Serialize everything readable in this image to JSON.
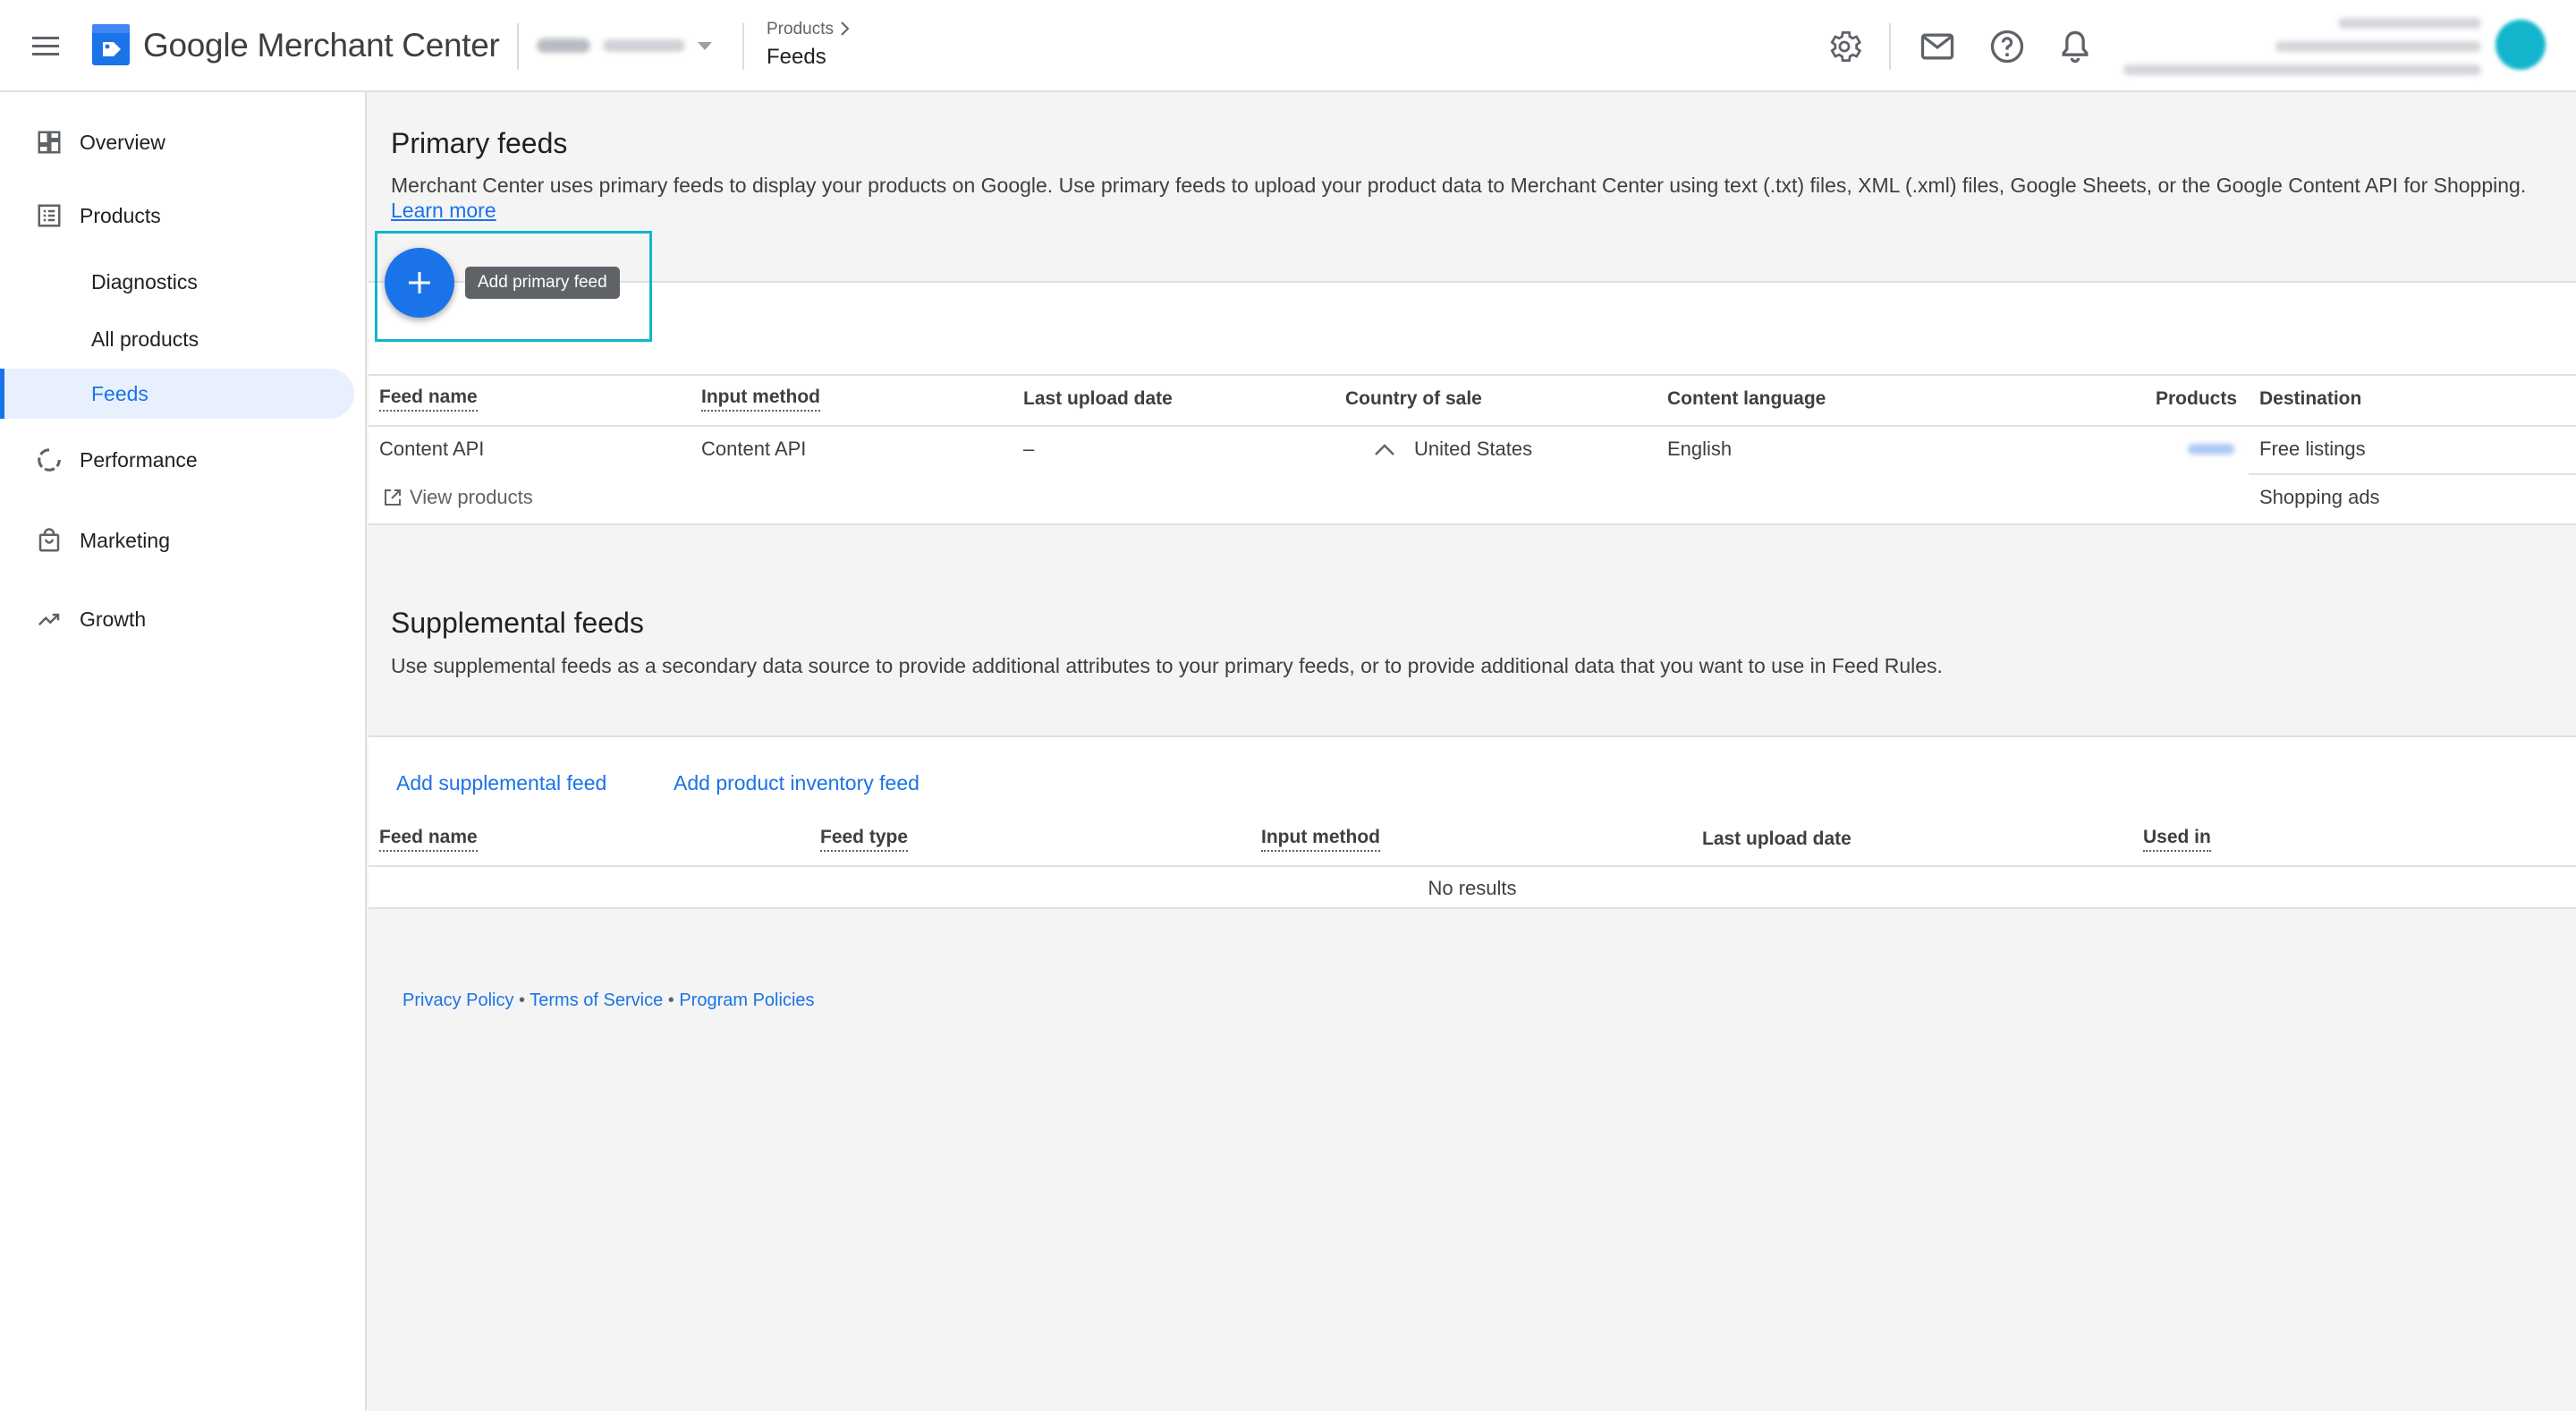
{
  "header": {
    "app_title": "Google Merchant Center",
    "breadcrumb_parent": "Products",
    "breadcrumb_current": "Feeds",
    "icons": [
      "settings-icon",
      "mail-icon",
      "help-icon",
      "notifications-icon"
    ]
  },
  "sidebar": {
    "items": [
      {
        "label": "Overview",
        "icon": "dashboard-icon"
      },
      {
        "label": "Products",
        "icon": "list-icon"
      },
      {
        "label": "Diagnostics"
      },
      {
        "label": "All products"
      },
      {
        "label": "Feeds",
        "active": true
      },
      {
        "label": "Performance",
        "icon": "donut-icon"
      },
      {
        "label": "Marketing",
        "icon": "shopping-bag-icon"
      },
      {
        "label": "Growth",
        "icon": "trending-up-icon"
      }
    ]
  },
  "primary": {
    "title": "Primary feeds",
    "desc": "Merchant Center uses primary feeds to display your products on Google. Use primary feeds to upload your product data to Merchant Center using text (.txt) files, XML (.xml) files, Google Sheets, or the Google Content API for Shopping.",
    "learn_more": "Learn more",
    "add_tooltip": "Add primary feed",
    "columns": [
      "Feed name",
      "Input method",
      "Last upload date",
      "Country of sale",
      "Content language",
      "Products",
      "Destination"
    ],
    "rows": [
      {
        "feed_name": "Content API",
        "input_method": "Content API",
        "last_upload": "–",
        "country": "United States",
        "language": "English",
        "destinations": [
          "Free listings",
          "Shopping ads"
        ],
        "view_products": "View products"
      }
    ]
  },
  "supplemental": {
    "title": "Supplemental feeds",
    "desc": "Use supplemental feeds as a secondary data source to provide additional attributes to your primary feeds, or to provide additional data that you want to use in Feed Rules.",
    "add_supplemental": "Add supplemental feed",
    "add_inventory": "Add product inventory feed",
    "columns": [
      "Feed name",
      "Feed type",
      "Input method",
      "Last upload date",
      "Used in"
    ],
    "empty": "No results"
  },
  "footer": {
    "privacy": "Privacy Policy",
    "terms": "Terms of Service",
    "program": "Program Policies",
    "sep": "•"
  },
  "colors": {
    "accent": "#1a73e8",
    "highlight": "#12b5cb"
  }
}
